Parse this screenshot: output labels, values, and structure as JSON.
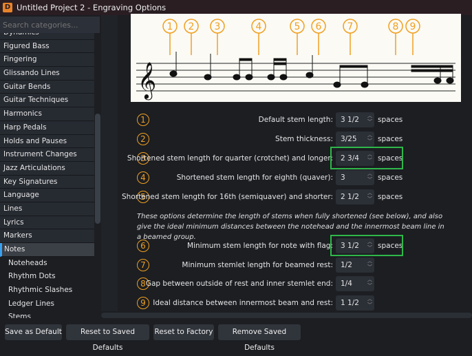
{
  "window": {
    "title": "Untitled Project 2 - Engraving Options",
    "icon": "D"
  },
  "sidebar": {
    "search_placeholder": "Search categories...",
    "items": [
      "Dynamics",
      "Figured Bass",
      "Fingering",
      "Glissando Lines",
      "Guitar Bends",
      "Guitar Techniques",
      "Harmonics",
      "Harp Pedals",
      "Holds and Pauses",
      "Instrument Changes",
      "Jazz Articulations",
      "Key Signatures",
      "Language",
      "Lines",
      "Lyrics",
      "Markers",
      "Notes"
    ],
    "selected": "Notes",
    "subitems": [
      "Noteheads",
      "Rhythm Dots",
      "Rhythmic Slashes",
      "Ledger Lines",
      "Stems"
    ]
  },
  "diagram": {
    "callouts": [
      "1",
      "2",
      "3",
      "4",
      "5",
      "6",
      "7",
      "8",
      "9"
    ]
  },
  "options": [
    {
      "num": "1",
      "label": "Default stem length:",
      "value": "3 1/2",
      "unit": "spaces"
    },
    {
      "num": "2",
      "label": "Stem thickness:",
      "value": "3/25",
      "unit": "spaces"
    },
    {
      "num": "3",
      "label": "Shortened stem length for quarter (crotchet) and longer:",
      "value": "2 3/4",
      "unit": "spaces"
    },
    {
      "num": "4",
      "label": "Shortened stem length for eighth (quaver):",
      "value": "3",
      "unit": "spaces"
    },
    {
      "num": "5",
      "label": "Shortened stem length for 16th (semiquaver) and shorter:",
      "value": "2 1/2",
      "unit": "spaces"
    },
    {
      "num": "6",
      "label": "Minimum stem length for note with flag:",
      "value": "3 1/2",
      "unit": "spaces"
    },
    {
      "num": "7",
      "label": "Minimum stemlet length for beamed rest:",
      "value": "1/2",
      "unit": ""
    },
    {
      "num": "8",
      "label": "Gap between outside of rest and inner stemlet end:",
      "value": "1/4",
      "unit": ""
    },
    {
      "num": "9",
      "label": "Ideal distance between innermost beam and rest:",
      "value": "1 1/2",
      "unit": ""
    }
  ],
  "description": "These options determine the length of stems when fully shortened (see below), and also give the ideal minimum distances between the notehead and the innermost beam line in a beamed group.",
  "buttons": [
    "Save as Default",
    "Reset to Saved Defaults",
    "Reset to Factory",
    "Remove Saved Defaults"
  ],
  "colors": {
    "accent": "#f0a020",
    "highlight": "#2fb84a",
    "selection": "#3aa0f0"
  }
}
